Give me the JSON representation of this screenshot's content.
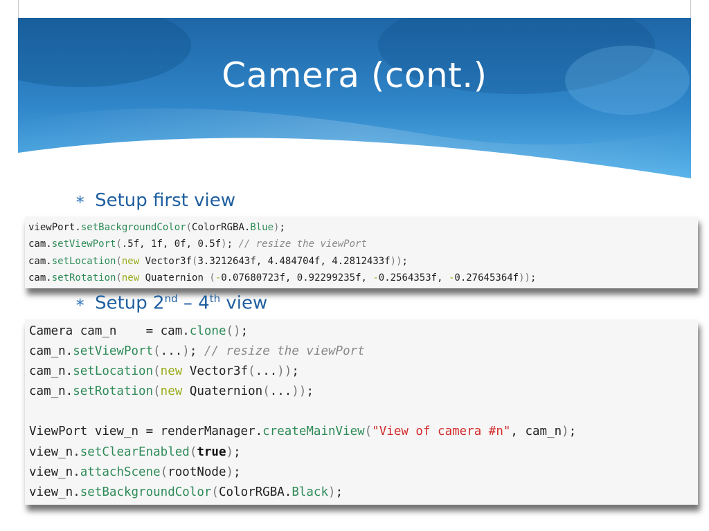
{
  "slide": {
    "title": "Camera (cont.)",
    "bullet1": {
      "symbol": "∗",
      "text": "Setup first view"
    },
    "bullet2": {
      "symbol": "∗",
      "pre": "Setup 2",
      "sup1": "nd",
      "mid": " – 4",
      "sup2": "th",
      "post": " view"
    }
  },
  "code_block_1": {
    "lines": [
      "viewPort.setBackgroundColor(ColorRGBA.Blue);",
      "cam.setViewPort(.5f, 1f, 0f, 0.5f); // resize the viewPort",
      "cam.setLocation(new Vector3f(3.3212643f, 4.484704f, 4.2812433f));",
      "cam.setRotation(new Quaternion (-0.07680723f, 0.92299235f, -0.2564353f, -0.27645364f));"
    ]
  },
  "code_block_2": {
    "lines": [
      "Camera cam_n    = cam.clone();",
      "cam_n.setViewPort(...); // resize the viewPort",
      "cam_n.setLocation(new Vector3f(...));",
      "cam_n.setRotation(new Quaternion(...));",
      "",
      "ViewPort view_n = renderManager.createMainView(\"View of camera #n\", cam_n);",
      "view_n.setClearEnabled(true);",
      "view_n.attachScene(rootNode);",
      "view_n.setBackgroundColor(ColorRGBA.Black);"
    ]
  },
  "theme": {
    "banner_top": "#2470b3",
    "banner_bottom": "#4aa6e0",
    "title_color": "#ffffff",
    "bullet_color": "#1f5fa0",
    "code_bg": "#f6f6f6",
    "method_color": "#2e8b57",
    "keyword_color": "#9aac1c",
    "comment_color": "#888888",
    "string_color": "#d22b2b"
  }
}
